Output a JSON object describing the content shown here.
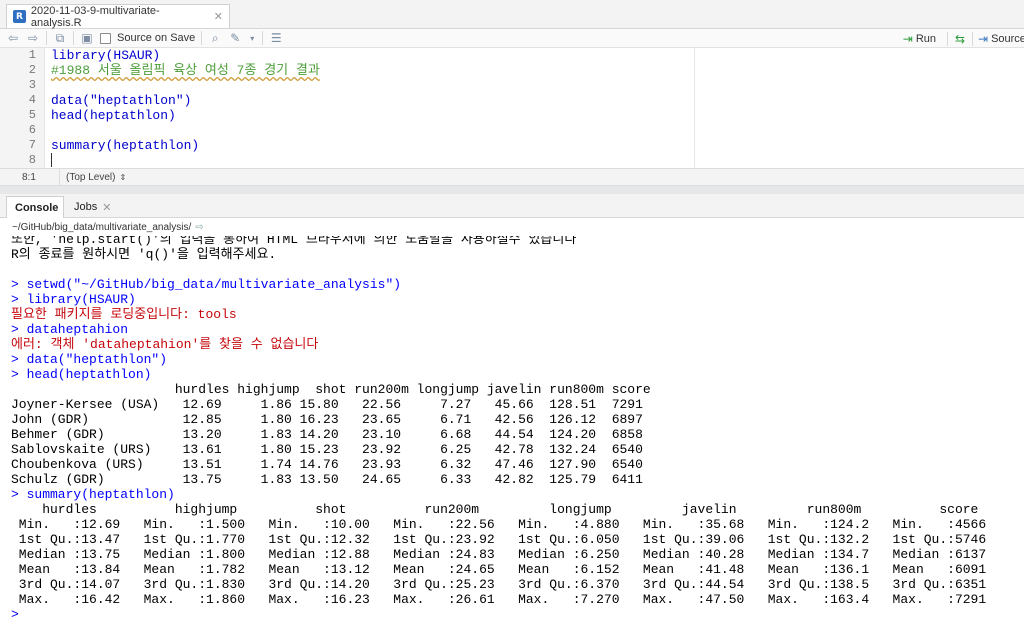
{
  "editor": {
    "tab_title": "2020-11-03-9-multivariate-analysis.R",
    "toolbar": {
      "source_on_save": "Source on Save",
      "run": "Run",
      "source": "Source"
    },
    "lines": [
      {
        "num": "1",
        "text": "library(HSAUR)"
      },
      {
        "num": "2",
        "text": "#1988 서울 올림픽 육상 여성 7종 경기 결과"
      },
      {
        "num": "3",
        "text": ""
      },
      {
        "num": "4",
        "text": "data(\"heptathlon\")"
      },
      {
        "num": "5",
        "text": "head(heptathlon)"
      },
      {
        "num": "6",
        "text": ""
      },
      {
        "num": "7",
        "text": "summary(heptathlon)"
      },
      {
        "num": "8",
        "text": ""
      }
    ],
    "status": {
      "position": "8:1",
      "scope": "(Top Level)"
    }
  },
  "console": {
    "tabs": [
      "Console",
      "Jobs"
    ],
    "path": "~/GitHub/big_data/multivariate_analysis/",
    "lines": [
      {
        "type": "out",
        "text": "또한, 'help.start()'의 입력을 통하여 HTML 브라우저에 의한 도움말을 사용하실수 있습니다"
      },
      {
        "type": "out",
        "text": "R의 종료를 원하시면 'q()'을 입력해주세요."
      },
      {
        "type": "out",
        "text": ""
      },
      {
        "type": "in",
        "text": "> setwd(\"~/GitHub/big_data/multivariate_analysis\")"
      },
      {
        "type": "in",
        "text": "> library(HSAUR)"
      },
      {
        "type": "err",
        "text": "필요한 패키지를 로딩중입니다: tools"
      },
      {
        "type": "in",
        "text": "> dataheptahion"
      },
      {
        "type": "err",
        "text": "에러: 객체 'dataheptahion'를 찾을 수 없습니다"
      },
      {
        "type": "in",
        "text": "> data(\"heptathlon\")"
      },
      {
        "type": "in",
        "text": "> head(heptathlon)"
      },
      {
        "type": "out",
        "text": "                     hurdles highjump  shot run200m longjump javelin run800m score"
      },
      {
        "type": "out",
        "text": "Joyner-Kersee (USA)   12.69     1.86 15.80   22.56     7.27   45.66  128.51  7291"
      },
      {
        "type": "out",
        "text": "John (GDR)            12.85     1.80 16.23   23.65     6.71   42.56  126.12  6897"
      },
      {
        "type": "out",
        "text": "Behmer (GDR)          13.20     1.83 14.20   23.10     6.68   44.54  124.20  6858"
      },
      {
        "type": "out",
        "text": "Sablovskaite (URS)    13.61     1.80 15.23   23.92     6.25   42.78  132.24  6540"
      },
      {
        "type": "out",
        "text": "Choubenkova (URS)     13.51     1.74 14.76   23.93     6.32   47.46  127.90  6540"
      },
      {
        "type": "out",
        "text": "Schulz (GDR)          13.75     1.83 13.50   24.65     6.33   42.82  125.79  6411"
      },
      {
        "type": "in",
        "text": "> summary(heptathlon)"
      },
      {
        "type": "out",
        "text": "    hurdles          highjump          shot          run200m         longjump         javelin         run800m          score     "
      },
      {
        "type": "out",
        "text": " Min.   :12.69   Min.   :1.500   Min.   :10.00   Min.   :22.56   Min.   :4.880   Min.   :35.68   Min.   :124.2   Min.   :4566  "
      },
      {
        "type": "out",
        "text": " 1st Qu.:13.47   1st Qu.:1.770   1st Qu.:12.32   1st Qu.:23.92   1st Qu.:6.050   1st Qu.:39.06   1st Qu.:132.2   1st Qu.:5746  "
      },
      {
        "type": "out",
        "text": " Median :13.75   Median :1.800   Median :12.88   Median :24.83   Median :6.250   Median :40.28   Median :134.7   Median :6137  "
      },
      {
        "type": "out",
        "text": " Mean   :13.84   Mean   :1.782   Mean   :13.12   Mean   :24.65   Mean   :6.152   Mean   :41.48   Mean   :136.1   Mean   :6091  "
      },
      {
        "type": "out",
        "text": " 3rd Qu.:14.07   3rd Qu.:1.830   3rd Qu.:14.20   3rd Qu.:25.23   3rd Qu.:6.370   3rd Qu.:44.54   3rd Qu.:138.5   3rd Qu.:6351  "
      },
      {
        "type": "out",
        "text": " Max.   :16.42   Max.   :1.860   Max.   :16.23   Max.   :26.61   Max.   :7.270   Max.   :47.50   Max.   :163.4   Max.   :7291  "
      },
      {
        "type": "in",
        "text": "> "
      }
    ]
  }
}
